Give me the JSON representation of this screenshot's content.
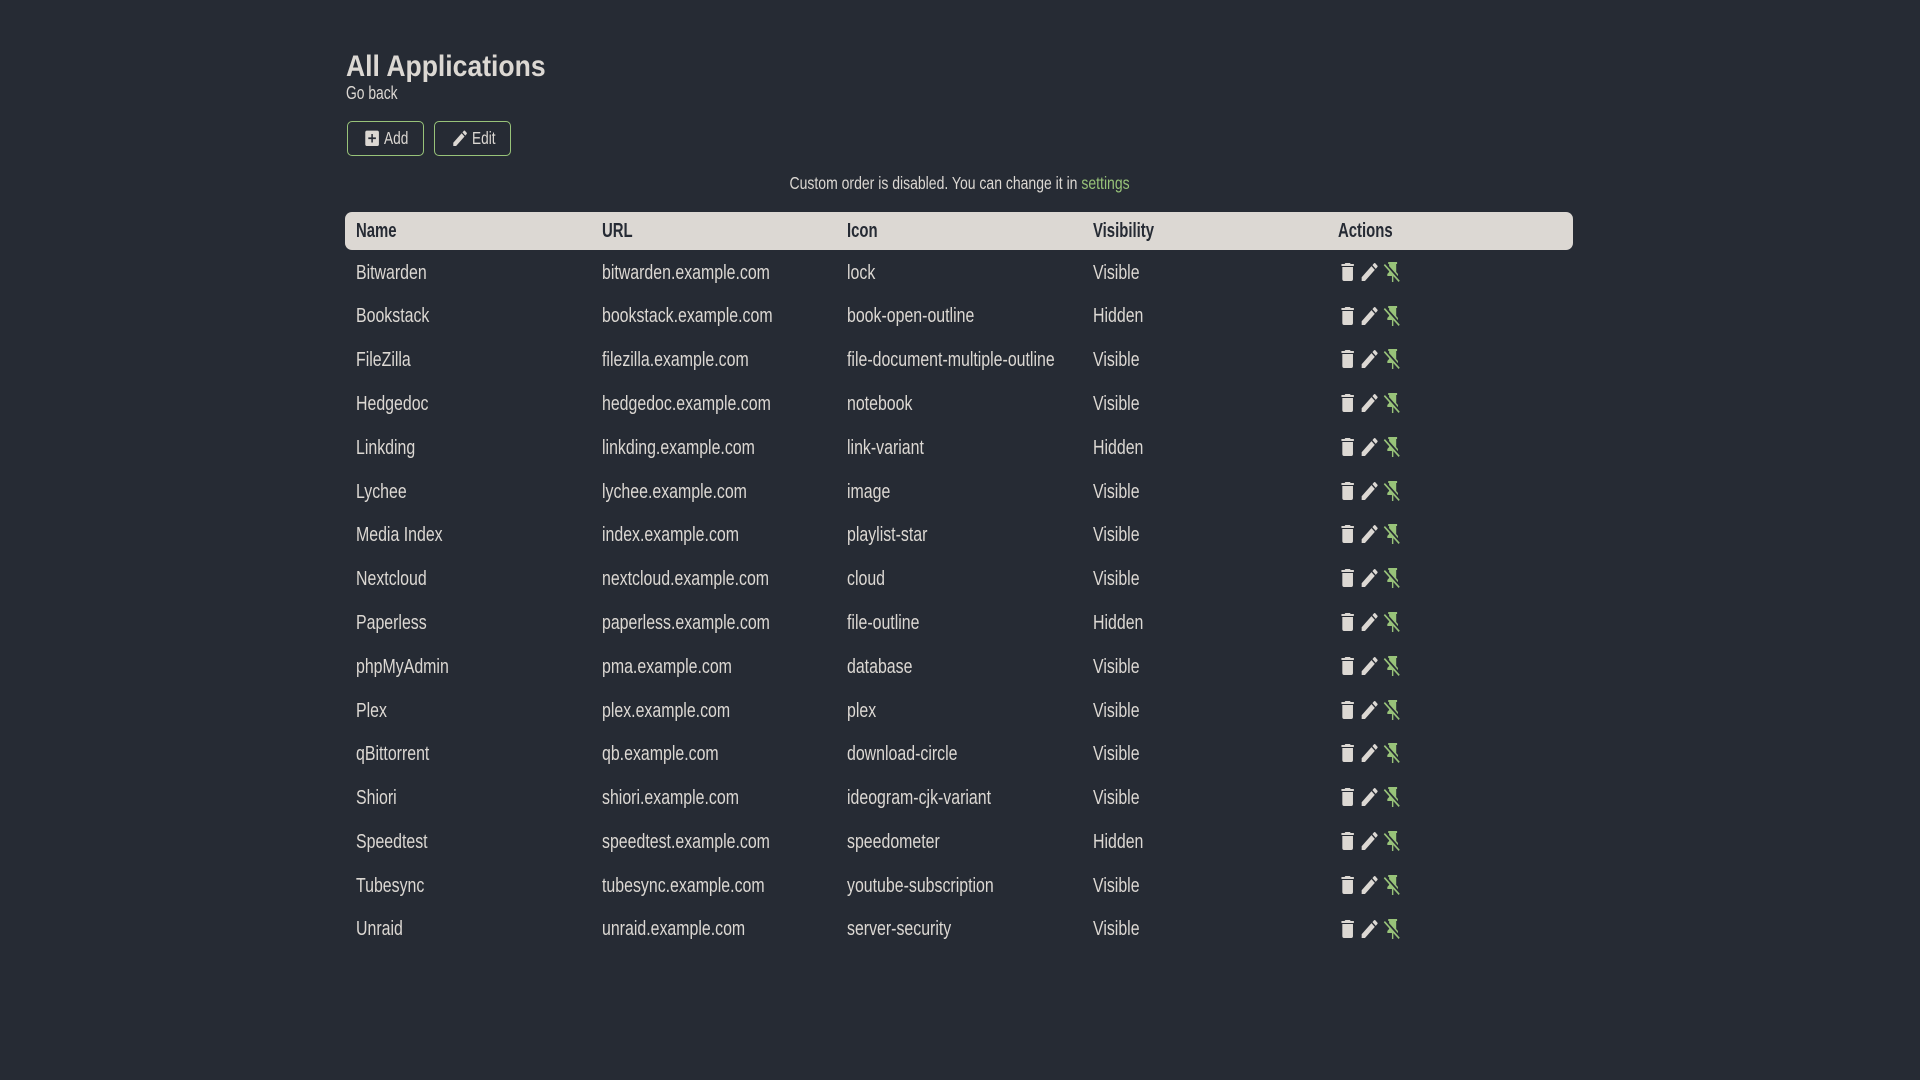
{
  "theme": {
    "background": "#262B34",
    "primary": "#DCD8D3",
    "accent": "#98C379"
  },
  "header": {
    "title": "All Applications",
    "back_link": "Go back"
  },
  "toolbar": {
    "add_label": "Add",
    "edit_label": "Edit"
  },
  "notice": {
    "prefix": "Custom order is disabled. You can change it in",
    "link_label": "settings"
  },
  "table": {
    "columns": [
      "Name",
      "URL",
      "Icon",
      "Visibility",
      "Actions"
    ],
    "action_icons": [
      "delete-icon",
      "pencil-icon",
      "pin-off-icon"
    ],
    "rows": [
      {
        "name": "Bitwarden",
        "url": "bitwarden.example.com",
        "icon": "lock",
        "visibility": "Visible"
      },
      {
        "name": "Bookstack",
        "url": "bookstack.example.com",
        "icon": "book-open-outline",
        "visibility": "Hidden"
      },
      {
        "name": "FileZilla",
        "url": "filezilla.example.com",
        "icon": "file-document-multiple-outline",
        "visibility": "Visible"
      },
      {
        "name": "Hedgedoc",
        "url": "hedgedoc.example.com",
        "icon": "notebook",
        "visibility": "Visible"
      },
      {
        "name": "Linkding",
        "url": "linkding.example.com",
        "icon": "link-variant",
        "visibility": "Hidden"
      },
      {
        "name": "Lychee",
        "url": "lychee.example.com",
        "icon": "image",
        "visibility": "Visible"
      },
      {
        "name": "Media Index",
        "url": "index.example.com",
        "icon": "playlist-star",
        "visibility": "Visible"
      },
      {
        "name": "Nextcloud",
        "url": "nextcloud.example.com",
        "icon": "cloud",
        "visibility": "Visible"
      },
      {
        "name": "Paperless",
        "url": "paperless.example.com",
        "icon": "file-outline",
        "visibility": "Hidden"
      },
      {
        "name": "phpMyAdmin",
        "url": "pma.example.com",
        "icon": "database",
        "visibility": "Visible"
      },
      {
        "name": "Plex",
        "url": "plex.example.com",
        "icon": "plex",
        "visibility": "Visible"
      },
      {
        "name": "qBittorrent",
        "url": "qb.example.com",
        "icon": "download-circle",
        "visibility": "Visible"
      },
      {
        "name": "Shiori",
        "url": "shiori.example.com",
        "icon": "ideogram-cjk-variant",
        "visibility": "Visible"
      },
      {
        "name": "Speedtest",
        "url": "speedtest.example.com",
        "icon": "speedometer",
        "visibility": "Hidden"
      },
      {
        "name": "Tubesync",
        "url": "tubesync.example.com",
        "icon": "youtube-subscription",
        "visibility": "Visible"
      },
      {
        "name": "Unraid",
        "url": "unraid.example.com",
        "icon": "server-security",
        "visibility": "Visible"
      }
    ]
  }
}
